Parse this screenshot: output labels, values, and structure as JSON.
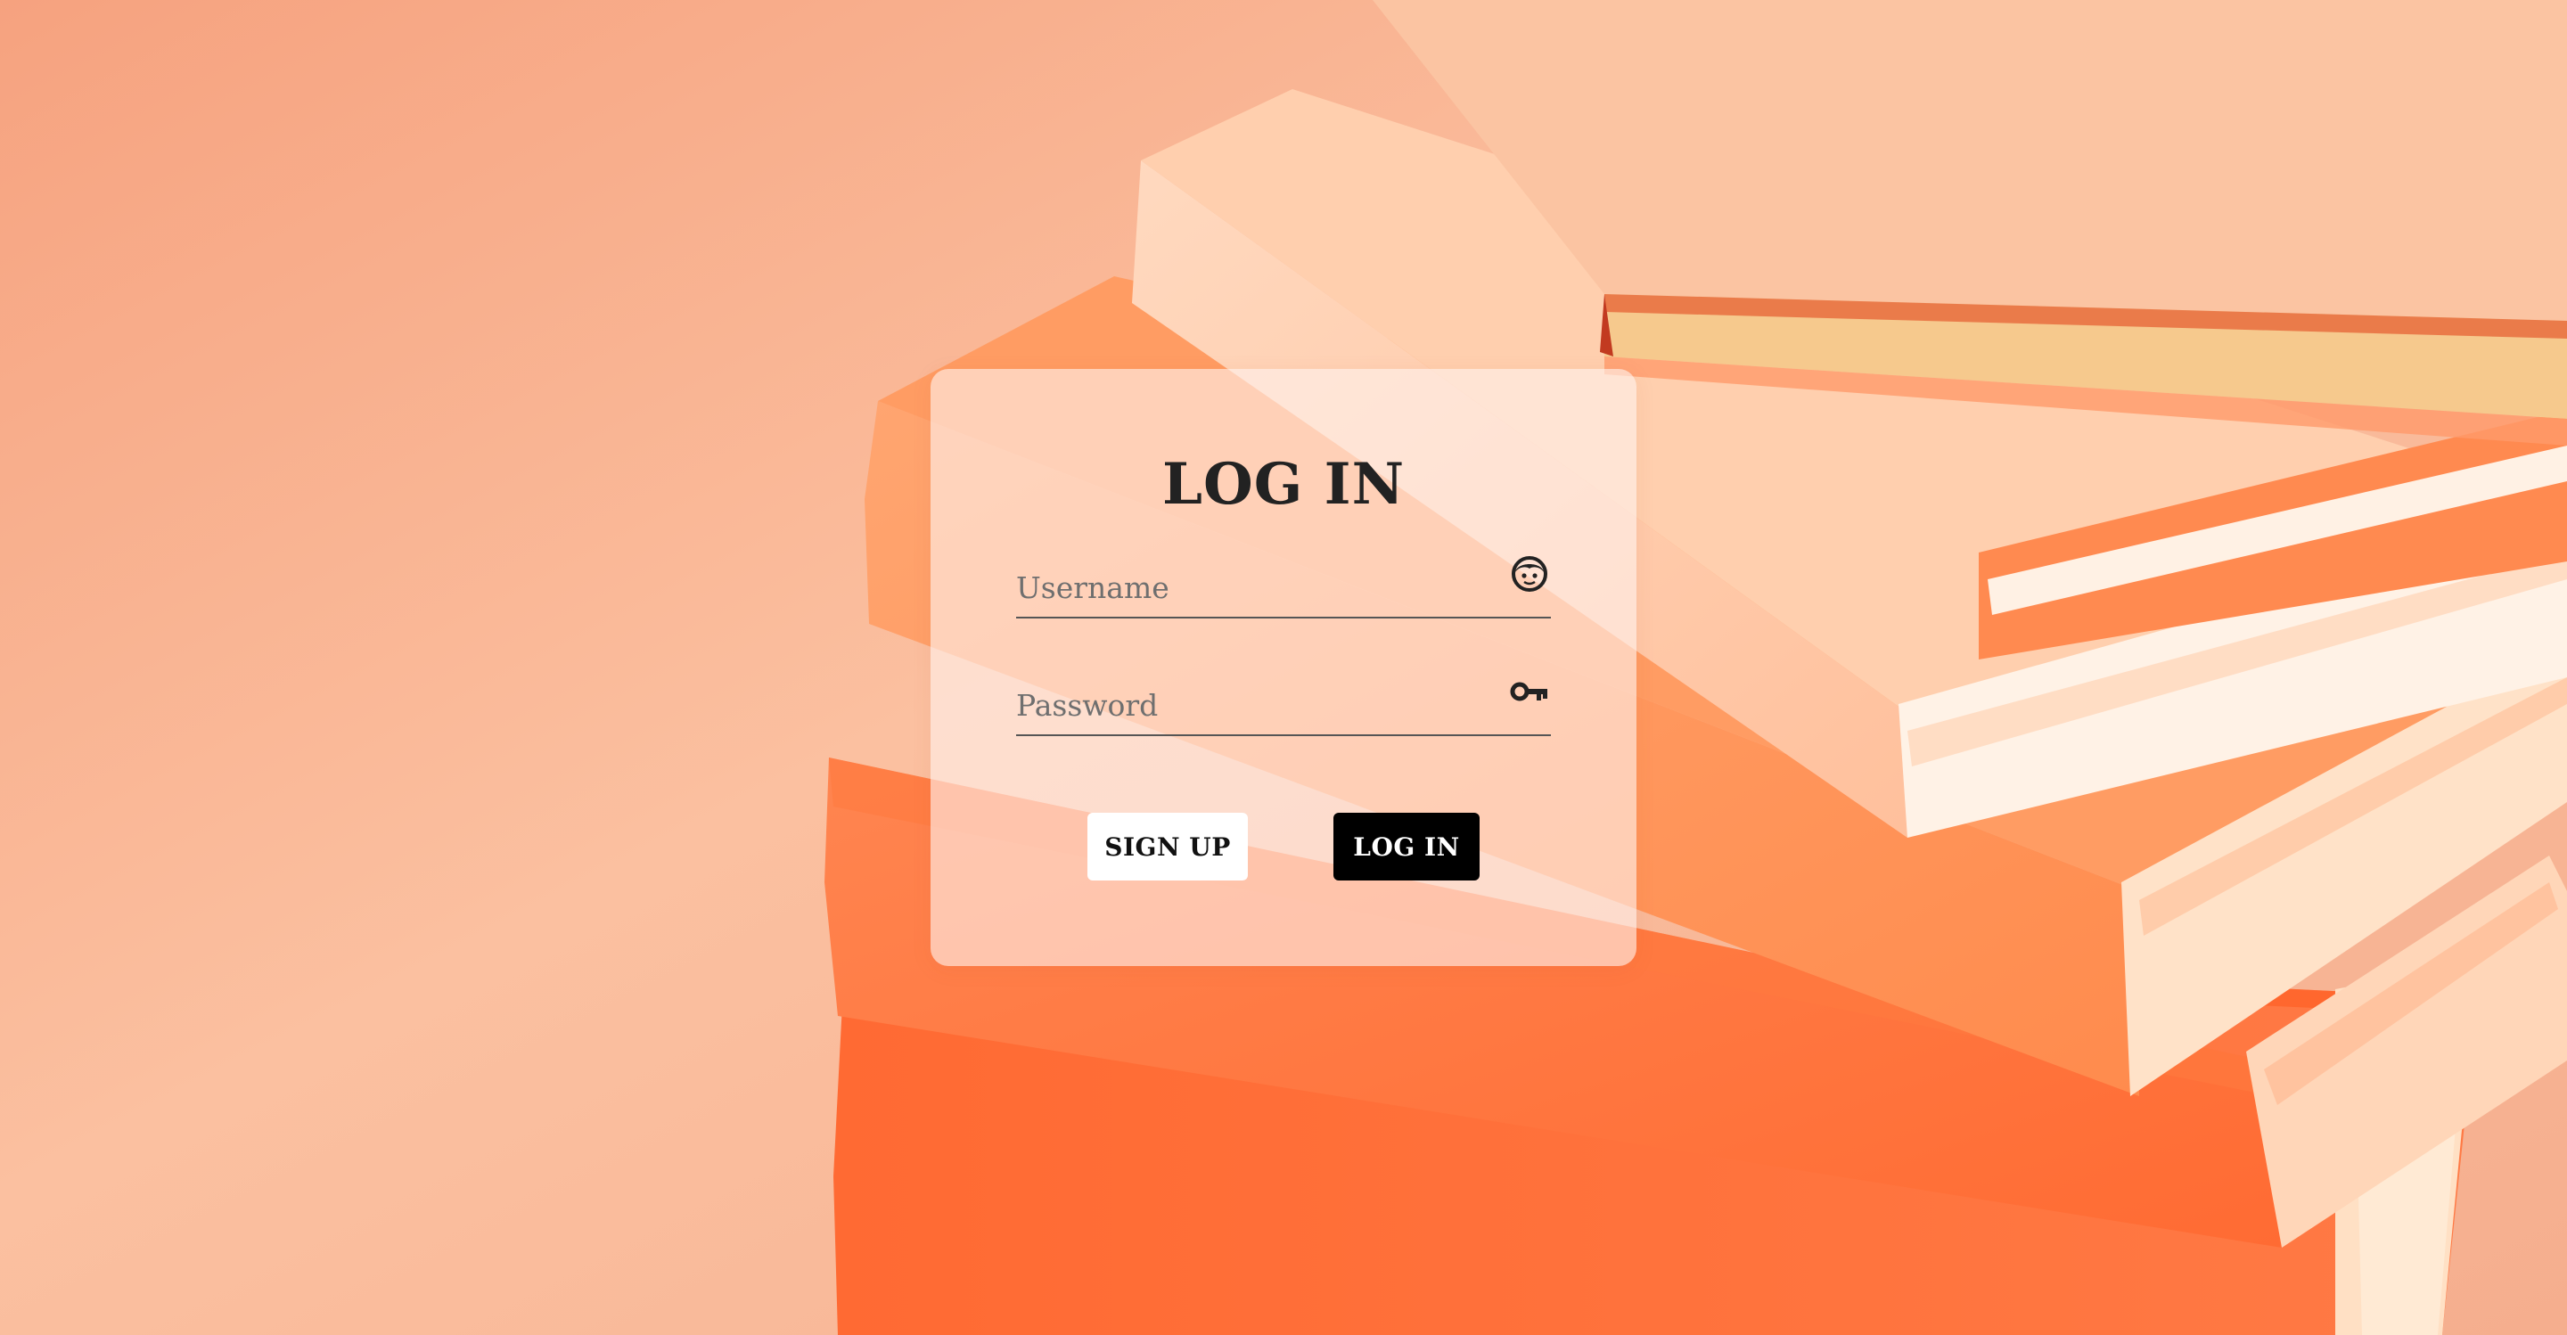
{
  "login": {
    "title": "LOG IN",
    "username": {
      "placeholder": "Username",
      "icon": "face-icon"
    },
    "password": {
      "placeholder": "Password",
      "icon": "key-icon"
    },
    "signup_label": "SIGN UP",
    "login_label": "LOG IN"
  },
  "colors": {
    "background": "#f9b896",
    "card": "#fff0eb",
    "login_button": "#000000",
    "signup_button": "#ffffff",
    "text": "#222222"
  }
}
